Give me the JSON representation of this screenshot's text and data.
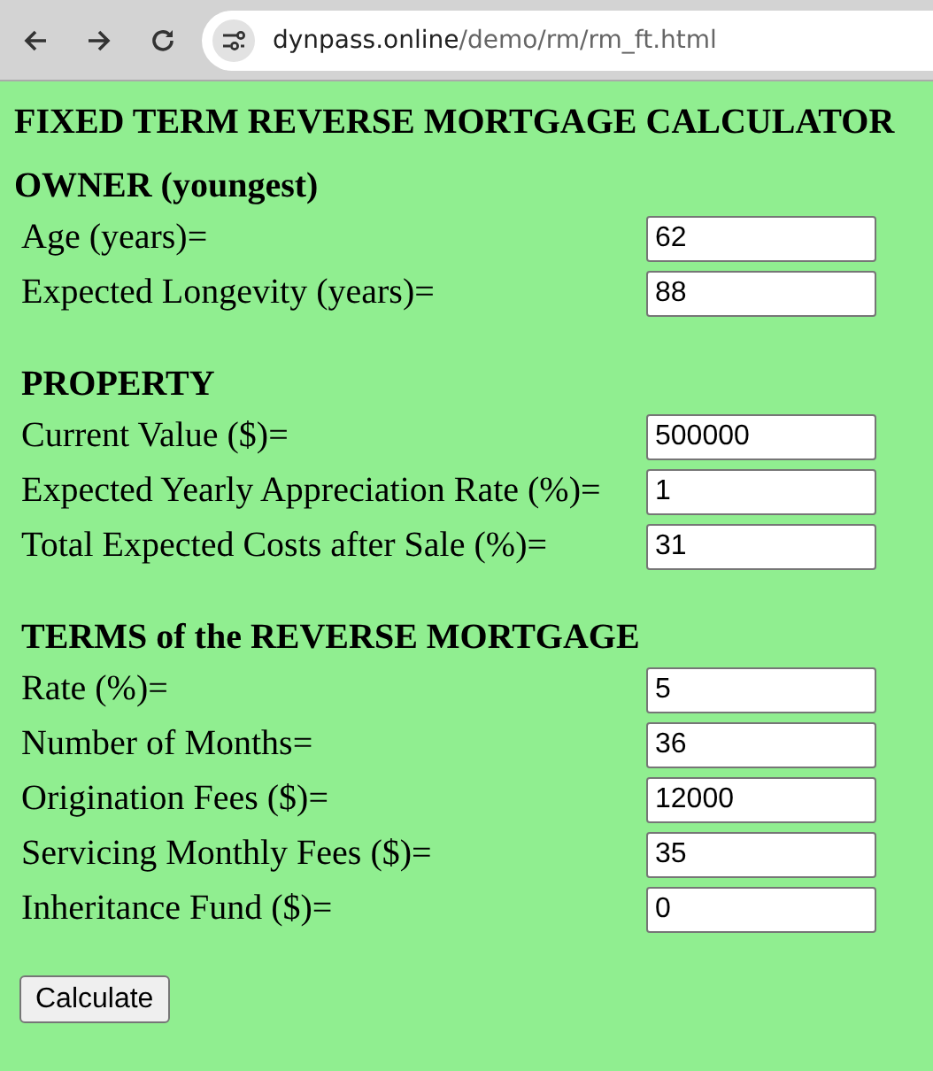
{
  "browser": {
    "url_host": "dynpass.online",
    "url_path": "/demo/rm/rm_ft.html"
  },
  "title": "FIXED TERM REVERSE MORTGAGE CALCULATOR",
  "sections": [
    {
      "heading": "OWNER (youngest)",
      "fields": [
        {
          "label": "Age (years)=",
          "value": "62"
        },
        {
          "label": "Expected Longevity (years)=",
          "value": "88"
        }
      ]
    },
    {
      "heading": "PROPERTY",
      "fields": [
        {
          "label": "Current Value ($)=",
          "value": "500000"
        },
        {
          "label": "Expected Yearly Appreciation Rate (%)=",
          "value": "1"
        },
        {
          "label": "Total Expected Costs after Sale (%)=",
          "value": "31"
        }
      ]
    },
    {
      "heading": "TERMS of the REVERSE MORTGAGE",
      "fields": [
        {
          "label": "Rate (%)=",
          "value": "5"
        },
        {
          "label": "Number of Months=",
          "value": "36"
        },
        {
          "label": "Origination Fees ($)=",
          "value": "12000"
        },
        {
          "label": "Servicing Monthly Fees ($)=",
          "value": "35"
        },
        {
          "label": "Inheritance Fund ($)=",
          "value": "0"
        }
      ]
    }
  ],
  "button": "Calculate"
}
